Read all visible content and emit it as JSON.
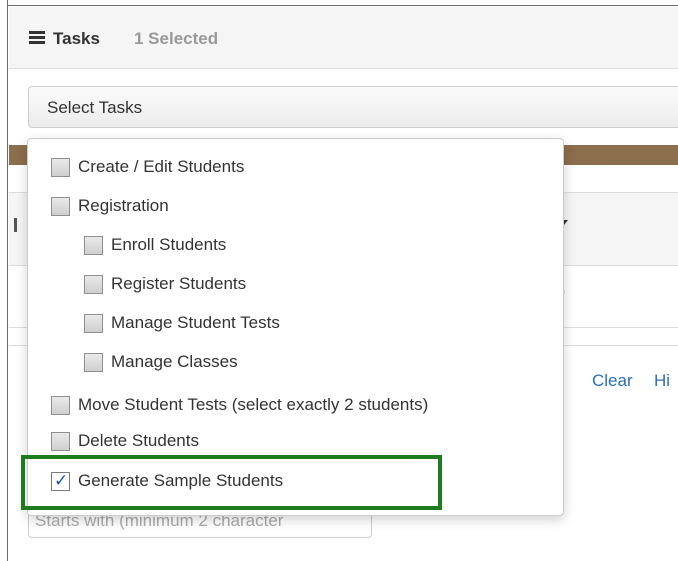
{
  "panel": {
    "icon": "list-icon",
    "title": "Tasks",
    "selected_count": "1 Selected"
  },
  "select": {
    "label": "Select Tasks"
  },
  "dropdown": {
    "items": [
      {
        "label": "Create / Edit Students",
        "checked": false,
        "indent": 0
      },
      {
        "label": "Registration",
        "checked": false,
        "indent": 0
      },
      {
        "label": "Enroll Students",
        "checked": false,
        "indent": 1
      },
      {
        "label": "Register Students",
        "checked": false,
        "indent": 1
      },
      {
        "label": "Manage Student Tests",
        "checked": false,
        "indent": 1
      },
      {
        "label": "Manage Classes",
        "checked": false,
        "indent": 1
      },
      {
        "label": "Move Student Tests (select exactly 2 students)",
        "checked": false,
        "indent": 0
      },
      {
        "label": "Delete Students",
        "checked": false,
        "indent": 0
      },
      {
        "label": "Generate Sample Students",
        "checked": true,
        "indent": 0
      }
    ]
  },
  "background": {
    "clear_link": "Clear",
    "hide_link": "Hi",
    "search_placeholder": "Starts with (minimum 2 character",
    "paren": ")"
  },
  "colors": {
    "highlight": "#1e7b1e",
    "band": "#8b6e4b",
    "link": "#2a6ebb"
  }
}
